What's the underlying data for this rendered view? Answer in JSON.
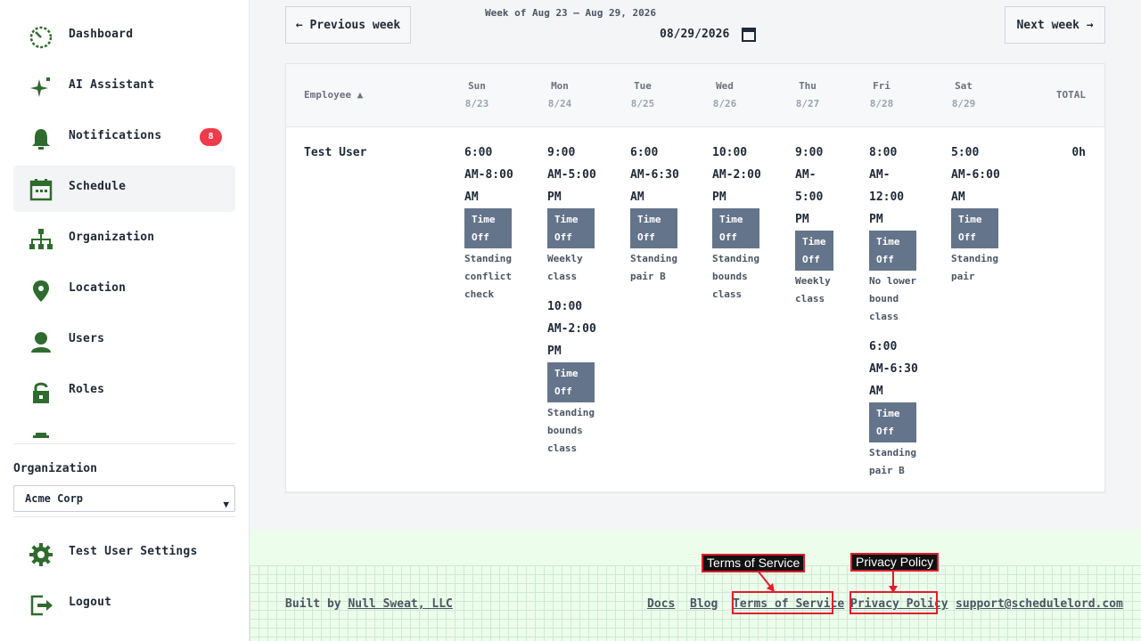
{
  "sidebar": {
    "items": [
      {
        "label": "Dashboard",
        "icon": "dashboard-icon"
      },
      {
        "label": "AI Assistant",
        "icon": "sparkle-icon"
      },
      {
        "label": "Notifications",
        "icon": "bell-icon",
        "badge": "8"
      },
      {
        "label": "Schedule",
        "icon": "calendar-icon",
        "active": true
      },
      {
        "label": "Organization",
        "icon": "org-chart-icon"
      },
      {
        "label": "Location",
        "icon": "location-pin-icon"
      },
      {
        "label": "Users",
        "icon": "user-icon"
      },
      {
        "label": "Roles",
        "icon": "lock-icon"
      }
    ],
    "org_label": "Organization",
    "org_selected": "Acme Corp",
    "settings_label": "Test User Settings",
    "logout_label": "Logout"
  },
  "schedule": {
    "prev_label": "← Previous week",
    "next_label": "Next week →",
    "week_caption": "Week of Aug 23 – Aug 29, 2026",
    "date_value": "08/29/2026",
    "employee_header": "Employee ▲",
    "total_header": "TOTAL",
    "days": [
      {
        "day": "Sun",
        "date": "8/23"
      },
      {
        "day": "Mon",
        "date": "8/24"
      },
      {
        "day": "Tue",
        "date": "8/25"
      },
      {
        "day": "Wed",
        "date": "8/26"
      },
      {
        "day": "Thu",
        "date": "8/27"
      },
      {
        "day": "Fri",
        "date": "8/28"
      },
      {
        "day": "Sat",
        "date": "8/29"
      }
    ],
    "employee": "Test User",
    "total": "0h",
    "shifts": {
      "sun": [
        {
          "time": [
            "6:00",
            "AM-8:00",
            "AM"
          ],
          "tag": [
            "Time",
            "Off"
          ],
          "note": [
            "Standing",
            "conflict",
            "check"
          ]
        }
      ],
      "mon": [
        {
          "time": [
            "9:00",
            "AM-5:00",
            "PM"
          ],
          "tag": [
            "Time",
            "Off"
          ],
          "note": [
            "Weekly",
            "class"
          ]
        },
        {
          "time": [
            "10:00",
            "AM-2:00",
            "PM"
          ],
          "tag": [
            "Time",
            "Off"
          ],
          "note": [
            "Standing",
            "bounds",
            "class"
          ]
        }
      ],
      "tue": [
        {
          "time": [
            "6:00",
            "AM-6:30",
            "AM"
          ],
          "tag": [
            "Time",
            "Off"
          ],
          "note": [
            "Standing",
            "pair B"
          ]
        }
      ],
      "wed": [
        {
          "time": [
            "10:00",
            "AM-2:00",
            "PM"
          ],
          "tag": [
            "Time",
            "Off"
          ],
          "note": [
            "Standing",
            "bounds",
            "class"
          ]
        }
      ],
      "thu": [
        {
          "time": [
            "9:00",
            "AM-",
            "5:00",
            "PM"
          ],
          "tag": [
            "Time",
            "Off"
          ],
          "note": [
            "Weekly",
            "class"
          ]
        }
      ],
      "fri": [
        {
          "time": [
            "8:00",
            "AM-",
            "12:00",
            "PM"
          ],
          "tag": [
            "Time",
            "Off"
          ],
          "note": [
            "No lower",
            "bound",
            "class"
          ]
        },
        {
          "time": [
            "6:00",
            "AM-6:30",
            "AM"
          ],
          "tag": [
            "Time",
            "Off"
          ],
          "note": [
            "Standing",
            "pair B"
          ]
        }
      ],
      "sat": [
        {
          "time": [
            "5:00",
            "AM-6:00",
            "AM"
          ],
          "tag": [
            "Time",
            "Off"
          ],
          "note": [
            "Standing",
            "pair"
          ]
        }
      ]
    }
  },
  "footer": {
    "built_prefix": "Built by",
    "built_link": "Null Sweat, LLC",
    "links": [
      "Docs",
      "Blog",
      "Terms of Service",
      "Privacy Policy",
      "support@schedulelord.com"
    ],
    "annotations": [
      "Terms of Service",
      "Privacy Policy"
    ]
  },
  "colors": {
    "accent_green": "#2f6b2f",
    "badge_red": "#ef3b4a",
    "timeoff_gray": "#64748b",
    "highlight_red": "#e11d2a"
  }
}
